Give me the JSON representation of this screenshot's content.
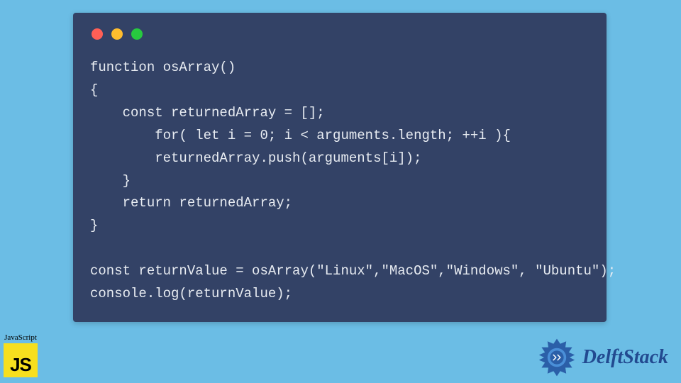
{
  "code": {
    "lines": [
      "function osArray()",
      "{",
      "    const returnedArray = [];",
      "        for( let i = 0; i < arguments.length; ++i ){",
      "        returnedArray.push(arguments[i]);",
      "    }",
      "    return returnedArray;",
      "}",
      "",
      "const returnValue = osArray(\"Linux\",\"MacOS\",\"Windows\", \"Ubuntu\");",
      "console.log(returnValue);"
    ]
  },
  "js_badge": {
    "label": "JavaScript",
    "logo_text": "JS"
  },
  "brand": {
    "name": "DelftStack"
  },
  "colors": {
    "page_bg": "#6bbde5",
    "window_bg": "#334266",
    "code_fg": "#e8ecf2",
    "js_yellow": "#f7df1e",
    "brand_blue": "#224a90"
  }
}
